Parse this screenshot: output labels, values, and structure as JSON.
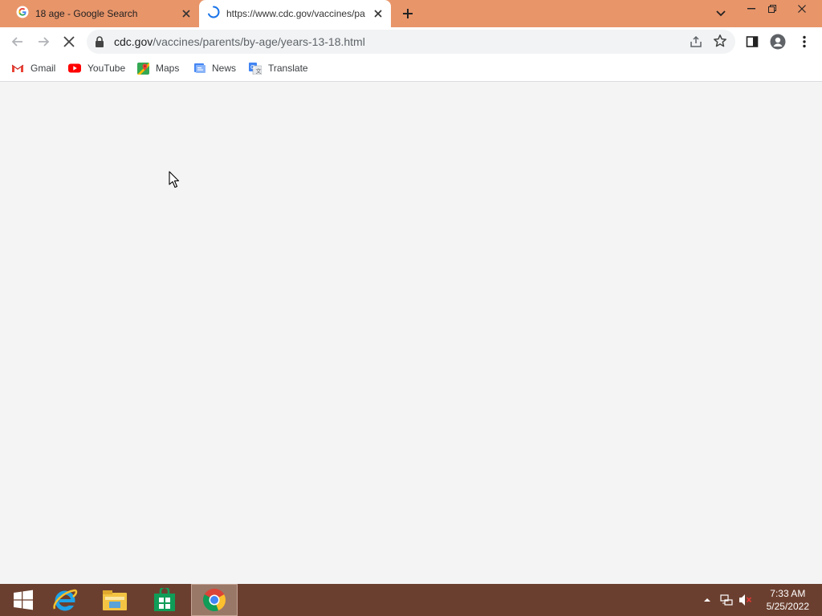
{
  "browser": {
    "tabs": [
      {
        "title": "18 age - Google Search",
        "icon": "google-icon"
      },
      {
        "title": "https://www.cdc.gov/vaccines/pa",
        "icon": "loading-spinner-icon"
      }
    ],
    "url_host": "cdc.gov",
    "url_path": "/vaccines/parents/by-age/years-13-18.html"
  },
  "bookmarks": [
    {
      "label": "Gmail",
      "icon": "gmail-icon"
    },
    {
      "label": "YouTube",
      "icon": "youtube-icon"
    },
    {
      "label": "Maps",
      "icon": "maps-icon"
    },
    {
      "label": "News",
      "icon": "news-icon"
    },
    {
      "label": "Translate",
      "icon": "translate-icon"
    }
  ],
  "taskbar": {
    "apps": [
      "internet-explorer-icon",
      "file-explorer-icon",
      "store-icon",
      "chrome-icon"
    ],
    "time": "7:33 AM",
    "date": "5/25/2022"
  },
  "colors": {
    "tab_strip": "#e8956a",
    "taskbar": "#6b3f2f",
    "page_bg": "#f4f4f5"
  }
}
